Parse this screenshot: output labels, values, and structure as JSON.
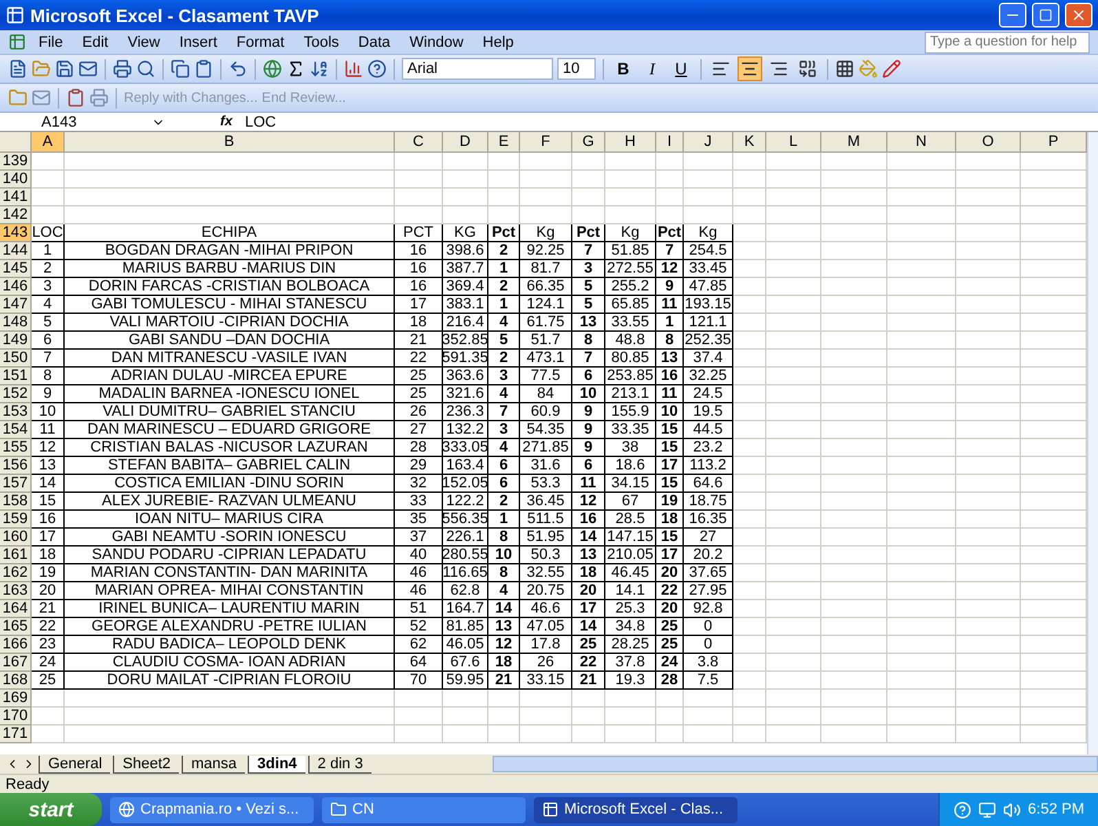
{
  "window": {
    "title": "Microsoft Excel - Clasament TAVP"
  },
  "menu": [
    "File",
    "Edit",
    "View",
    "Insert",
    "Format",
    "Tools",
    "Data",
    "Window",
    "Help"
  ],
  "help_box": {
    "placeholder": "Type a question for help"
  },
  "formatting": {
    "font": "Arial",
    "size": "10",
    "styles": [
      {
        "kind": "bold",
        "label": "B"
      },
      {
        "kind": "italic",
        "label": "I"
      },
      {
        "kind": "underline",
        "label": "U"
      }
    ],
    "align": [
      {
        "kind": "left",
        "selected": false
      },
      {
        "kind": "center",
        "selected": true
      },
      {
        "kind": "right",
        "selected": false
      },
      {
        "kind": "merge",
        "selected": false
      }
    ]
  },
  "review_toolbar": {
    "reply": "Reply with Changes...",
    "end": "End Review..."
  },
  "formula_bar": {
    "name_box": "A143",
    "function_label": "fx",
    "formula": "LOC"
  },
  "columns": [
    {
      "label": "A",
      "selected": true
    },
    {
      "label": "B",
      "selected": false
    },
    {
      "label": "C",
      "selected": false
    },
    {
      "label": "D",
      "selected": false
    },
    {
      "label": "E",
      "selected": false
    },
    {
      "label": "F",
      "selected": false
    },
    {
      "label": "G",
      "selected": false
    },
    {
      "label": "H",
      "selected": false
    },
    {
      "label": "I",
      "selected": false
    },
    {
      "label": "J",
      "selected": false
    },
    {
      "label": "K",
      "selected": false
    },
    {
      "label": "L",
      "selected": false
    },
    {
      "label": "M",
      "selected": false
    },
    {
      "label": "N",
      "selected": false
    },
    {
      "label": "O",
      "selected": false
    },
    {
      "label": "P",
      "selected": false
    }
  ],
  "rows": [
    {
      "label": "139",
      "selected": false
    },
    {
      "label": "140",
      "selected": false
    },
    {
      "label": "141",
      "selected": false
    },
    {
      "label": "142",
      "selected": false
    },
    {
      "label": "143",
      "selected": true,
      "cells": [
        "LOC",
        "ECHIPA",
        "PCT",
        "KG",
        "Pct",
        "Kg",
        "Pct",
        "Kg",
        "Pct",
        "Kg"
      ]
    },
    {
      "label": "144",
      "selected": false,
      "cells": [
        "1",
        "BOGDAN DRAGAN -MIHAI PRIPON",
        "16",
        "398.6",
        "2",
        "92.25",
        "7",
        "51.85",
        "7",
        "254.5"
      ]
    },
    {
      "label": "145",
      "selected": false,
      "cells": [
        "2",
        "MARIUS BARBU -MARIUS DIN",
        "16",
        "387.7",
        "1",
        "81.7",
        "3",
        "272.55",
        "12",
        "33.45"
      ]
    },
    {
      "label": "146",
      "selected": false,
      "cells": [
        "3",
        "DORIN FARCAS -CRISTIAN BOLBOACA",
        "16",
        "369.4",
        "2",
        "66.35",
        "5",
        "255.2",
        "9",
        "47.85"
      ]
    },
    {
      "label": "147",
      "selected": false,
      "cells": [
        "4",
        "GABI TOMULESCU - MIHAI STANESCU",
        "17",
        "383.1",
        "1",
        "124.1",
        "5",
        "65.85",
        "11",
        "193.15"
      ]
    },
    {
      "label": "148",
      "selected": false,
      "cells": [
        "5",
        "VALI MARTOIU -CIPRIAN DOCHIA",
        "18",
        "216.4",
        "4",
        "61.75",
        "13",
        "33.55",
        "1",
        "121.1"
      ]
    },
    {
      "label": "149",
      "selected": false,
      "cells": [
        "6",
        "GABI SANDU –DAN DOCHIA",
        "21",
        "352.85",
        "5",
        "51.7",
        "8",
        "48.8",
        "8",
        "252.35"
      ]
    },
    {
      "label": "150",
      "selected": false,
      "cells": [
        "7",
        "DAN MITRANESCU -VASILE IVAN",
        "22",
        "591.35",
        "2",
        "473.1",
        "7",
        "80.85",
        "13",
        "37.4"
      ]
    },
    {
      "label": "151",
      "selected": false,
      "cells": [
        "8",
        "ADRIAN DULAU -MIRCEA EPURE",
        "25",
        "363.6",
        "3",
        "77.5",
        "6",
        "253.85",
        "16",
        "32.25"
      ]
    },
    {
      "label": "152",
      "selected": false,
      "cells": [
        "9",
        "MADALIN BARNEA -IONESCU IONEL",
        "25",
        "321.6",
        "4",
        "84",
        "10",
        "213.1",
        "11",
        "24.5"
      ]
    },
    {
      "label": "153",
      "selected": false,
      "cells": [
        "10",
        "VALI DUMITRU– GABRIEL STANCIU",
        "26",
        "236.3",
        "7",
        "60.9",
        "9",
        "155.9",
        "10",
        "19.5"
      ]
    },
    {
      "label": "154",
      "selected": false,
      "cells": [
        "11",
        "DAN MARINESCU – EDUARD GRIGORE",
        "27",
        "132.2",
        "3",
        "54.35",
        "9",
        "33.35",
        "15",
        "44.5"
      ]
    },
    {
      "label": "155",
      "selected": false,
      "cells": [
        "12",
        "CRISTIAN BALAS -NICUSOR LAZURAN",
        "28",
        "333.05",
        "4",
        "271.85",
        "9",
        "38",
        "15",
        "23.2"
      ]
    },
    {
      "label": "156",
      "selected": false,
      "cells": [
        "13",
        "STEFAN BABITA– GABRIEL CALIN",
        "29",
        "163.4",
        "6",
        "31.6",
        "6",
        "18.6",
        "17",
        "113.2"
      ]
    },
    {
      "label": "157",
      "selected": false,
      "cells": [
        "14",
        "COSTICA EMILIAN -DINU SORIN",
        "32",
        "152.05",
        "6",
        "53.3",
        "11",
        "34.15",
        "15",
        "64.6"
      ]
    },
    {
      "label": "158",
      "selected": false,
      "cells": [
        "15",
        "ALEX JUREBIE- RAZVAN ULMEANU",
        "33",
        "122.2",
        "2",
        "36.45",
        "12",
        "67",
        "19",
        "18.75"
      ]
    },
    {
      "label": "159",
      "selected": false,
      "cells": [
        "16",
        "IOAN NITU– MARIUS CIRA",
        "35",
        "556.35",
        "1",
        "511.5",
        "16",
        "28.5",
        "18",
        "16.35"
      ]
    },
    {
      "label": "160",
      "selected": false,
      "cells": [
        "17",
        "GABI NEAMTU -SORIN IONESCU",
        "37",
        "226.1",
        "8",
        "51.95",
        "14",
        "147.15",
        "15",
        "27"
      ]
    },
    {
      "label": "161",
      "selected": false,
      "cells": [
        "18",
        "SANDU PODARU -CIPRIAN LEPADATU",
        "40",
        "280.55",
        "10",
        "50.3",
        "13",
        "210.05",
        "17",
        "20.2"
      ]
    },
    {
      "label": "162",
      "selected": false,
      "cells": [
        "19",
        "MARIAN CONSTANTIN- DAN MARINITA",
        "46",
        "116.65",
        "8",
        "32.55",
        "18",
        "46.45",
        "20",
        "37.65"
      ]
    },
    {
      "label": "163",
      "selected": false,
      "cells": [
        "20",
        "MARIAN OPREA- MIHAI CONSTANTIN",
        "46",
        "62.8",
        "4",
        "20.75",
        "20",
        "14.1",
        "22",
        "27.95"
      ]
    },
    {
      "label": "164",
      "selected": false,
      "cells": [
        "21",
        "IRINEL BUNICA– LAURENTIU MARIN",
        "51",
        "164.7",
        "14",
        "46.6",
        "17",
        "25.3",
        "20",
        "92.8"
      ]
    },
    {
      "label": "165",
      "selected": false,
      "cells": [
        "22",
        "GEORGE ALEXANDRU -PETRE IULIAN",
        "52",
        "81.85",
        "13",
        "47.05",
        "14",
        "34.8",
        "25",
        "0"
      ]
    },
    {
      "label": "166",
      "selected": false,
      "cells": [
        "23",
        "RADU BADICA– LEOPOLD DENK",
        "62",
        "46.05",
        "12",
        "17.8",
        "25",
        "28.25",
        "25",
        "0"
      ]
    },
    {
      "label": "167",
      "selected": false,
      "cells": [
        "24",
        "CLAUDIU COSMA- IOAN ADRIAN",
        "64",
        "67.6",
        "18",
        "26",
        "22",
        "37.8",
        "24",
        "3.8"
      ]
    },
    {
      "label": "168",
      "selected": false,
      "cells": [
        "25",
        "DORU MAILAT -CIPRIAN FLOROIU",
        "70",
        "59.95",
        "21",
        "33.15",
        "21",
        "19.3",
        "28",
        "7.5"
      ]
    },
    {
      "label": "169",
      "selected": false
    },
    {
      "label": "170",
      "selected": false
    },
    {
      "label": "171",
      "selected": false
    }
  ],
  "sheet_tabs": [
    {
      "label": "General",
      "selected": false
    },
    {
      "label": "Sheet2",
      "selected": false
    },
    {
      "label": "mansa",
      "selected": false
    },
    {
      "label": "3din4",
      "selected": true
    },
    {
      "label": "2 din 3",
      "selected": false
    }
  ],
  "status_bar": {
    "text": "Ready"
  },
  "taskbar": {
    "start": "start",
    "items": [
      {
        "kind": "browser",
        "label": "Crapmania.ro • Vezi s...",
        "selected": false
      },
      {
        "kind": "folder",
        "label": "CN",
        "selected": false
      },
      {
        "kind": "excel",
        "label": "Microsoft Excel - Clas...",
        "selected": true
      }
    ],
    "clock": "6:52 PM"
  }
}
